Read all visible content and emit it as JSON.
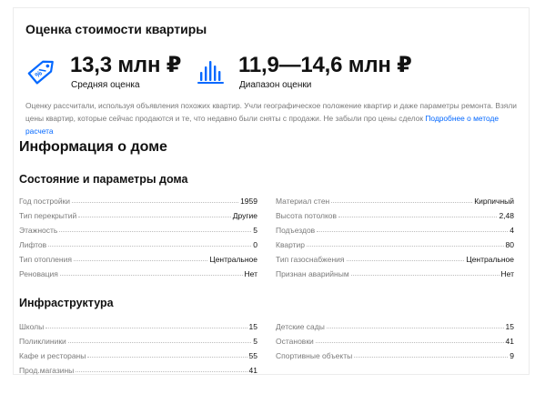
{
  "price": {
    "title": "Оценка стоимости квартиры",
    "average": {
      "value": "13,3 млн ₽",
      "label": "Средняя оценка",
      "icon": "price-tag-icon"
    },
    "range": {
      "value": "11,9—14,6 млн ₽",
      "label": "Диапазон оценки",
      "icon": "bar-range-icon"
    },
    "note_text": "Оценку рассчитали, используя объявления похожих квартир. Учли географическое положение квартир и даже параметры ремонта. Взяли цены квартир, которые сейчас продаются и те, что недавно были сняты с продажи. Не забыли про цены сделок ",
    "note_link": "Подробнее о методе расчета",
    "accent_color": "#0468ff"
  },
  "house": {
    "title": "Информация о доме",
    "condition": {
      "title": "Состояние и параметры дома",
      "left": [
        {
          "label": "Год постройки",
          "value": "1959"
        },
        {
          "label": "Тип перекрытий",
          "value": "Другие"
        },
        {
          "label": "Этажность",
          "value": "5"
        },
        {
          "label": "Лифтов",
          "value": "0"
        },
        {
          "label": "Тип отопления",
          "value": "Центральное"
        },
        {
          "label": "Реновация",
          "value": "Нет"
        }
      ],
      "right": [
        {
          "label": "Материал стен",
          "value": "Кирпичный"
        },
        {
          "label": "Высота потолков",
          "value": "2,48"
        },
        {
          "label": "Подъездов",
          "value": "4"
        },
        {
          "label": "Квартир",
          "value": "80"
        },
        {
          "label": "Тип газоснабжения",
          "value": "Центральное"
        },
        {
          "label": "Признан аварийным",
          "value": "Нет"
        }
      ]
    },
    "infrastructure": {
      "title": "Инфраструктура",
      "left": [
        {
          "label": "Школы",
          "value": "15"
        },
        {
          "label": "Поликлиники",
          "value": "5"
        },
        {
          "label": "Кафе и рестораны",
          "value": "55"
        },
        {
          "label": "Прод.магазины",
          "value": "41"
        }
      ],
      "right": [
        {
          "label": "Детские сады",
          "value": "15"
        },
        {
          "label": "Остановки",
          "value": "41"
        },
        {
          "label": "Спортивные объекты",
          "value": "9"
        }
      ]
    }
  }
}
